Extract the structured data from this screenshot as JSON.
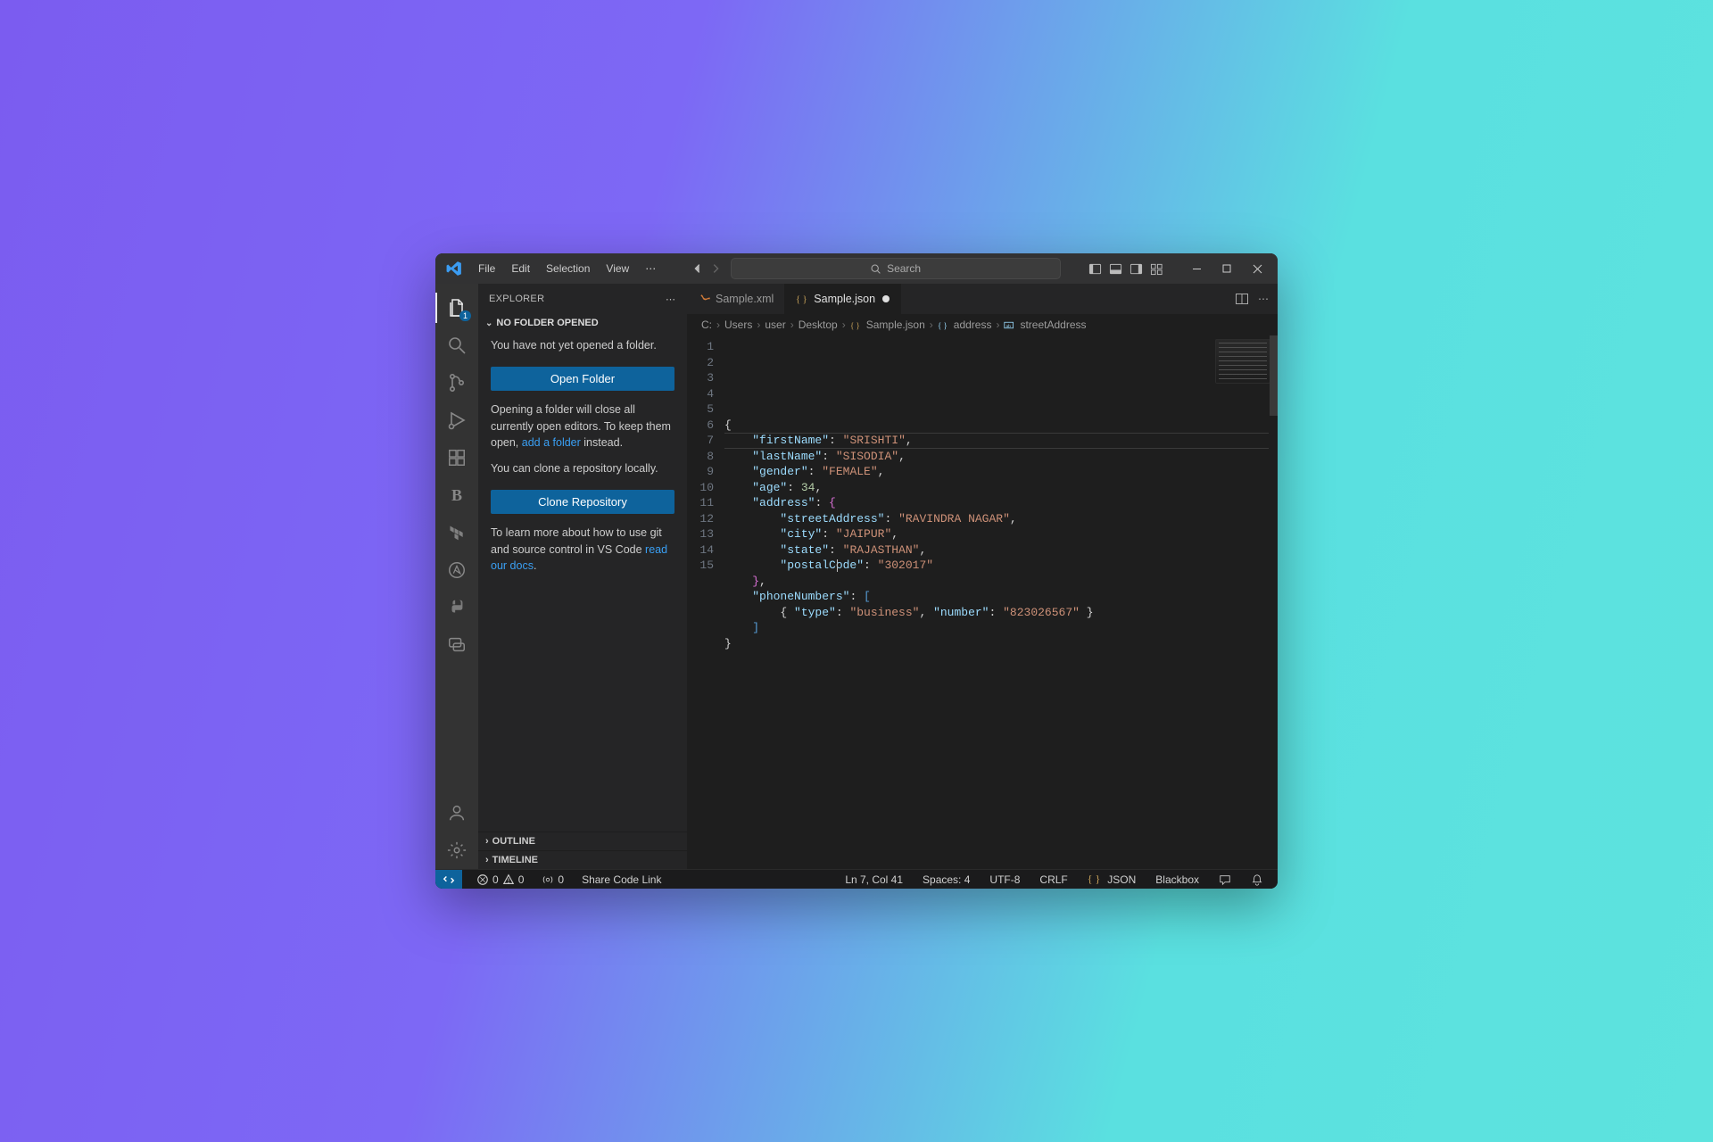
{
  "menu": [
    "File",
    "Edit",
    "Selection",
    "View"
  ],
  "search_placeholder": "Search",
  "activity_badge": "1",
  "sidebar": {
    "title": "EXPLORER",
    "section": "NO FOLDER OPENED",
    "p1": "You have not yet opened a folder.",
    "btn_open": "Open Folder",
    "p2a": "Opening a folder will close all currently open editors. To keep them open, ",
    "p2link": "add a folder",
    "p2b": " instead.",
    "p3": "You can clone a repository locally.",
    "btn_clone": "Clone Repository",
    "p4a": "To learn more about how to use git and source control in VS Code ",
    "p4link": "read our docs",
    "p4b": ".",
    "outline": "OUTLINE",
    "timeline": "TIMELINE"
  },
  "tabs": [
    {
      "label": "Sample.xml",
      "icon": "xml",
      "active": false
    },
    {
      "label": "Sample.json",
      "icon": "json",
      "active": true,
      "dirty": true
    }
  ],
  "breadcrumbs": [
    "C:",
    "Users",
    "user",
    "Desktop",
    "Sample.json",
    "address",
    "streetAddress"
  ],
  "code_lines": [
    [
      [
        "brace",
        "{"
      ]
    ],
    [
      [
        "pad",
        "    "
      ],
      [
        "key",
        "\"firstName\""
      ],
      [
        "brace",
        ": "
      ],
      [
        "str",
        "\"SRISHTI\""
      ],
      [
        "brace",
        ","
      ]
    ],
    [
      [
        "pad",
        "    "
      ],
      [
        "key",
        "\"lastName\""
      ],
      [
        "brace",
        ": "
      ],
      [
        "str",
        "\"SISODIA\""
      ],
      [
        "brace",
        ","
      ]
    ],
    [
      [
        "pad",
        "    "
      ],
      [
        "key",
        "\"gender\""
      ],
      [
        "brace",
        ": "
      ],
      [
        "str",
        "\"FEMALE\""
      ],
      [
        "brace",
        ","
      ]
    ],
    [
      [
        "pad",
        "    "
      ],
      [
        "key",
        "\"age\""
      ],
      [
        "brace",
        ": "
      ],
      [
        "num",
        "34"
      ],
      [
        "brace",
        ","
      ]
    ],
    [
      [
        "pad",
        "    "
      ],
      [
        "key",
        "\"address\""
      ],
      [
        "brace",
        ": "
      ],
      [
        "brk",
        "{"
      ]
    ],
    [
      [
        "pad",
        "        "
      ],
      [
        "key",
        "\"streetAddress\""
      ],
      [
        "brace",
        ": "
      ],
      [
        "str",
        "\"RAVINDRA NAGAR\""
      ],
      [
        "brace",
        ","
      ]
    ],
    [
      [
        "pad",
        "        "
      ],
      [
        "key",
        "\"city\""
      ],
      [
        "brace",
        ": "
      ],
      [
        "str",
        "\"JAIPUR\""
      ],
      [
        "brace",
        ","
      ]
    ],
    [
      [
        "pad",
        "        "
      ],
      [
        "key",
        "\"state\""
      ],
      [
        "brace",
        ": "
      ],
      [
        "str",
        "\"RAJASTHAN\""
      ],
      [
        "brace",
        ","
      ]
    ],
    [
      [
        "pad",
        "        "
      ],
      [
        "key",
        "\"postalCode\""
      ],
      [
        "brace",
        ": "
      ],
      [
        "str",
        "\"302017\""
      ]
    ],
    [
      [
        "pad",
        "    "
      ],
      [
        "brk",
        "}"
      ],
      [
        "brace",
        ","
      ]
    ],
    [
      [
        "pad",
        "    "
      ],
      [
        "key",
        "\"phoneNumbers\""
      ],
      [
        "brace",
        ": "
      ],
      [
        "brk2",
        "["
      ]
    ],
    [
      [
        "pad",
        "        "
      ],
      [
        "brace",
        "{ "
      ],
      [
        "key",
        "\"type\""
      ],
      [
        "brace",
        ": "
      ],
      [
        "str",
        "\"business\""
      ],
      [
        "brace",
        ", "
      ],
      [
        "key",
        "\"number\""
      ],
      [
        "brace",
        ": "
      ],
      [
        "str",
        "\"823026567\""
      ],
      [
        "brace",
        " }"
      ]
    ],
    [
      [
        "pad",
        "    "
      ],
      [
        "brk2",
        "]"
      ]
    ],
    [
      [
        "brace",
        "}"
      ]
    ]
  ],
  "status": {
    "errors": "0",
    "warnings": "0",
    "ports": "0",
    "share": "Share Code Link",
    "lncol": "Ln 7, Col 41",
    "spaces": "Spaces: 4",
    "enc": "UTF-8",
    "eol": "CRLF",
    "lang": "JSON",
    "blackbox": "Blackbox"
  }
}
